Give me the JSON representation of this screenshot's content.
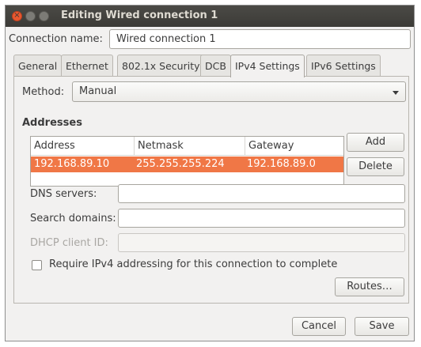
{
  "window": {
    "title": "Editing Wired connection 1"
  },
  "connection_name": {
    "label": "Connection name:",
    "value": "Wired connection 1"
  },
  "tabs": [
    {
      "label": "General"
    },
    {
      "label": "Ethernet"
    },
    {
      "label": "802.1x Security"
    },
    {
      "label": "DCB"
    },
    {
      "label": "IPv4 Settings",
      "active": true
    },
    {
      "label": "IPv6 Settings"
    }
  ],
  "method": {
    "label": "Method:",
    "value": "Manual"
  },
  "addresses": {
    "heading": "Addresses",
    "columns": [
      "Address",
      "Netmask",
      "Gateway"
    ],
    "rows": [
      {
        "address": "192.168.89.10",
        "netmask": "255.255.255.224",
        "gateway": "192.168.89.0",
        "selected": true
      }
    ],
    "add_label": "Add",
    "delete_label": "Delete"
  },
  "dns": {
    "label": "DNS servers:",
    "value": ""
  },
  "search_domains": {
    "label": "Search domains:",
    "value": ""
  },
  "dhcp_client_id": {
    "label": "DHCP client ID:",
    "value": ""
  },
  "require_ipv4": {
    "label": "Require IPv4 addressing for this connection to complete",
    "checked": false
  },
  "routes_label": "Routes…",
  "footer": {
    "cancel_label": "Cancel",
    "save_label": "Save"
  },
  "colors": {
    "selection": "#f07746",
    "titlebar": "#3c3b37",
    "close_button": "#e9572f"
  }
}
